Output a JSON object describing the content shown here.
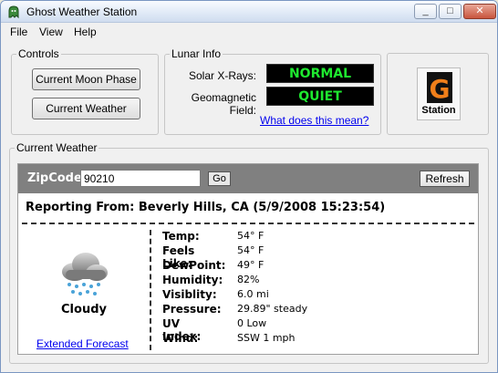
{
  "window": {
    "title": "Ghost Weather Station",
    "buttons": {
      "minimize": "_",
      "maximize": "□",
      "close": "✕"
    }
  },
  "menu": [
    "File",
    "View",
    "Help"
  ],
  "controls": {
    "legend": "Controls",
    "moon_button": "Current Moon Phase",
    "weather_button": "Current Weather"
  },
  "lunar": {
    "legend": "Lunar Info",
    "solar_label": "Solar X-Rays:",
    "solar_value": "NORMAL",
    "geo_label": "Geomagnetic Field:",
    "geo_value": "QUIET",
    "link": "What does this mean?"
  },
  "logo": {
    "letter": "G",
    "text": "Station"
  },
  "weather": {
    "legend": "Current Weather",
    "zip_label": "ZipCode:",
    "zip_value": "90210",
    "go_label": "Go",
    "refresh_label": "Refresh",
    "reporting": "Reporting From: Beverly Hills, CA (5/9/2008 15:23:54)",
    "condition": "Cloudy",
    "extended_link": "Extended Forecast",
    "stats": [
      {
        "label": "Temp:",
        "value": "54° F"
      },
      {
        "label": "Feels Like:",
        "value": "54° F"
      },
      {
        "label": "DewPoint:",
        "value": "49° F"
      },
      {
        "label": "Humidity:",
        "value": "82%"
      },
      {
        "label": "Visiblity:",
        "value": "6.0 mi"
      },
      {
        "label": "Pressure:",
        "value": "29.89\" steady"
      },
      {
        "label": "UV Index:",
        "value": "0 Low"
      },
      {
        "label": "Wind:",
        "value": "SSW 1 mph"
      }
    ]
  },
  "colors": {
    "led_green": "#1eea2f",
    "logo_orange": "#f07f1a",
    "zip_bar": "#808080"
  },
  "icons": [
    "ghost-app-icon",
    "cloud-snow-icon",
    "g-logo-icon"
  ]
}
